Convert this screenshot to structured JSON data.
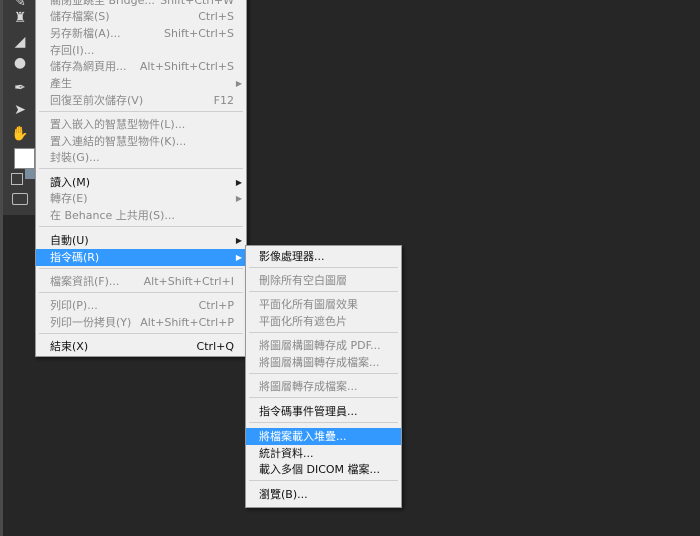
{
  "file_menu": {
    "items": [
      {
        "label": "關閉並跳至 Bridge...",
        "shortcut": "Shift+Ctrl+W",
        "disabled": true,
        "arrow": false
      },
      {
        "label": "儲存檔案(S)",
        "shortcut": "Ctrl+S",
        "disabled": true,
        "arrow": false
      },
      {
        "label": "另存新檔(A)...",
        "shortcut": "Shift+Ctrl+S",
        "disabled": true,
        "arrow": false
      },
      {
        "label": "存回(I)...",
        "shortcut": "",
        "disabled": true,
        "arrow": false
      },
      {
        "label": "儲存為網頁用...",
        "shortcut": "Alt+Shift+Ctrl+S",
        "disabled": true,
        "arrow": false
      },
      {
        "label": "產生",
        "shortcut": "",
        "disabled": true,
        "arrow": true
      },
      {
        "label": "回復至前次儲存(V)",
        "shortcut": "F12",
        "disabled": true,
        "arrow": false
      },
      {
        "label": "置入嵌入的智慧型物件(L)...",
        "shortcut": "",
        "disabled": true,
        "arrow": false
      },
      {
        "label": "置入連結的智慧型物件(K)...",
        "shortcut": "",
        "disabled": true,
        "arrow": false
      },
      {
        "label": "封裝(G)...",
        "shortcut": "",
        "disabled": true,
        "arrow": false
      },
      {
        "label": "讀入(M)",
        "shortcut": "",
        "disabled": false,
        "arrow": true
      },
      {
        "label": "轉存(E)",
        "shortcut": "",
        "disabled": true,
        "arrow": true
      },
      {
        "label": "在 Behance 上共用(S)...",
        "shortcut": "",
        "disabled": true,
        "arrow": false
      },
      {
        "label": "自動(U)",
        "shortcut": "",
        "disabled": false,
        "arrow": true
      },
      {
        "label": "指令碼(R)",
        "shortcut": "",
        "disabled": false,
        "arrow": true,
        "selected": true
      },
      {
        "label": "檔案資訊(F)...",
        "shortcut": "Alt+Shift+Ctrl+I",
        "disabled": true,
        "arrow": false
      },
      {
        "label": "列印(P)...",
        "shortcut": "Ctrl+P",
        "disabled": true,
        "arrow": false
      },
      {
        "label": "列印一份拷貝(Y)",
        "shortcut": "Alt+Shift+Ctrl+P",
        "disabled": true,
        "arrow": false
      },
      {
        "label": "結束(X)",
        "shortcut": "Ctrl+Q",
        "disabled": false,
        "arrow": false
      }
    ]
  },
  "scripts_menu": {
    "items": [
      {
        "label": "影像處理器...",
        "disabled": false
      },
      {
        "label": "刪除所有空白圖層",
        "disabled": true
      },
      {
        "label": "平面化所有圖層效果",
        "disabled": true
      },
      {
        "label": "平面化所有遮色片",
        "disabled": true
      },
      {
        "label": "將圖層構圖轉存成 PDF...",
        "disabled": true
      },
      {
        "label": "將圖層構圖轉存成檔案...",
        "disabled": true
      },
      {
        "label": "將圖層轉存成檔案...",
        "disabled": true
      },
      {
        "label": "指令碼事件管理員...",
        "disabled": false
      },
      {
        "label": "將檔案載入堆疊...",
        "disabled": false,
        "selected": true
      },
      {
        "label": "統計資料...",
        "disabled": false
      },
      {
        "label": "載入多個 DICOM 檔案...",
        "disabled": false
      },
      {
        "label": "瀏覽(B)...",
        "disabled": false
      }
    ]
  },
  "toolbar": {
    "icons": [
      "clone-stamp-icon",
      "eraser-icon",
      "blur-drop-icon",
      "pen-tool-icon",
      "path-selection-icon",
      "hand-tool-icon"
    ]
  },
  "colors": {
    "menu_bg": "#f0f0f0",
    "highlight": "#3399ff",
    "workspace": "#262626",
    "disabled_text": "#8a8a8a"
  }
}
